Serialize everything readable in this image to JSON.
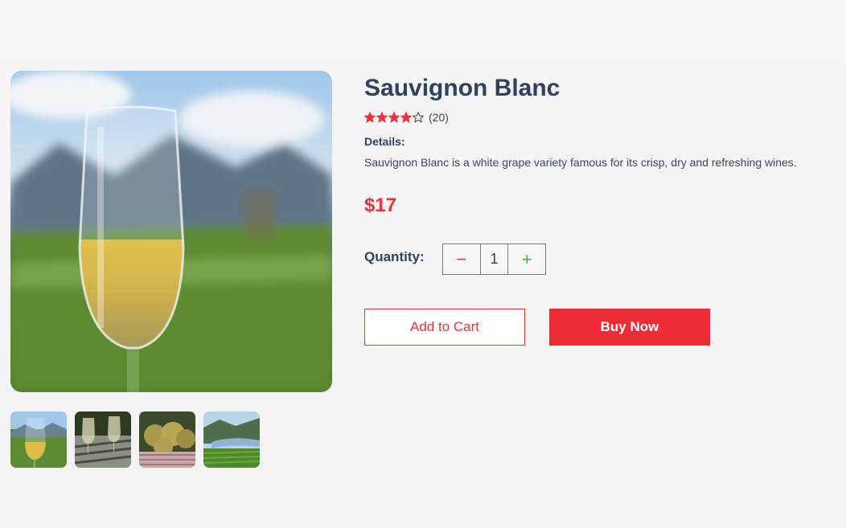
{
  "product": {
    "title": "Sauvignon Blanc",
    "rating": 4,
    "rating_max": 5,
    "review_count": "(20)",
    "details_label": "Details:",
    "description": "Sauvignon Blanc is a white grape variety famous for its crisp, dry and refreshing wines.",
    "price": "$17"
  },
  "quantity": {
    "label": "Quantity:",
    "minus_symbol": "−",
    "plus_symbol": "+",
    "value": "1"
  },
  "actions": {
    "add_to_cart_label": "Add to Cart",
    "buy_now_label": "Buy Now"
  },
  "gallery": {
    "main_image": "wine-glass-vineyard-photo",
    "thumbnails": [
      {
        "subject": "wine-glass-vineyard-photo"
      },
      {
        "subject": "wine-glasses-table-photo"
      },
      {
        "subject": "grape-harvest-bins-photo"
      },
      {
        "subject": "vineyard-river-valley-photo"
      }
    ]
  },
  "colors": {
    "accent": "#e8343d",
    "heading": "#2c4461",
    "plus": "#4caf50",
    "star": "#e8343d"
  }
}
